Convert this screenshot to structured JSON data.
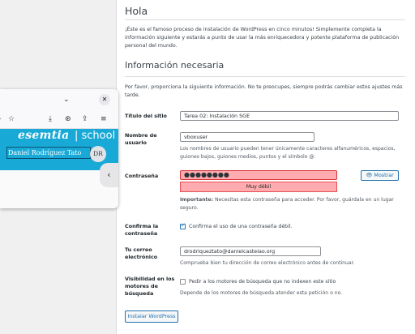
{
  "wp": {
    "heading": "Hola",
    "intro": "¡Éste es el famoso proceso de instalación de WordPress en cinco minutos! Simplemente completa la información siguiente y estarás a punto de usar la más enriquecedora y potente plataforma de publicación personal del mundo.",
    "section_title": "Información necesaria",
    "section_para": "Por favor, proporciona la siguiente información. No te preocupes, siempre podrás cambiar estos ajustes más tarde.",
    "site_title": {
      "label": "Título del sitio",
      "value": "Tarea 02: Instalación SGE"
    },
    "username": {
      "label": "Nombre de usuario",
      "value": "vboxuser",
      "desc": "Los nombres de usuario pueden tener únicamente caracteres alfanuméricos, espacios, guiones bajos, guiones medios, puntos y el símbolo @."
    },
    "password": {
      "label": "Contraseña",
      "value": "●●●●●●●●",
      "show_button": "Mostrar",
      "strength": "Muy débil",
      "important_bold": "Importante:",
      "important_text": " Necesitas esta contraseña para acceder. Por favor, guárdala en un lugar seguro."
    },
    "confirm": {
      "label": "Confirma la contraseña",
      "checkbox_label": "Confirma el uso de una contraseña débil.",
      "checked": true
    },
    "email": {
      "label": "Tu correo electrónico",
      "value": "drodriqueztato@danielcastelao.org",
      "desc": "Comprueba bien tu dirección de correo electrónico antes de continuar."
    },
    "visibility": {
      "label": "Visibilidad en los motores de búsqueda",
      "checkbox_label": "Pedir a los motores de búsqueda que no indexen este sitio",
      "desc": "Depende de los motores de búsqueda atender esta petición o no.",
      "checked": false
    },
    "install_button": "Instalar WordPress"
  },
  "popup": {
    "brand": "esemtia",
    "brand_suffix": "| school",
    "user_name": "Daniel Rodríguez Tato",
    "initials": "DR",
    "icons": [
      "chevron-down-icon",
      "close-icon",
      "star-icon",
      "download-icon",
      "extensions-icon",
      "share-icon",
      "menu-icon",
      "chevron-left-icon"
    ]
  },
  "colors": {
    "accent": "#2271b1",
    "banner": "#18a9d6",
    "weak_pw": "#ffabaf"
  }
}
